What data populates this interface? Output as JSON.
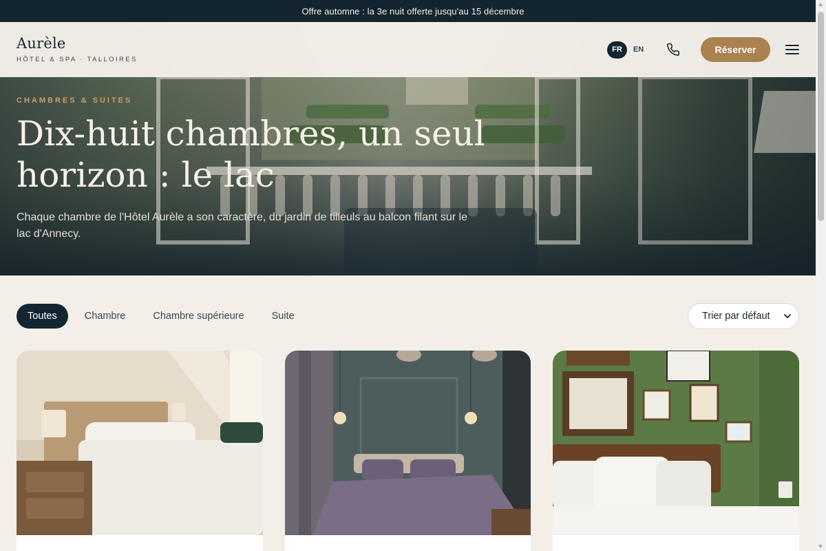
{
  "promo": {
    "text": "Offre automne : la 3e nuit offerte jusqu'au 15 décembre"
  },
  "header": {
    "brand_name": "Aurèle",
    "brand_tag": "HÔTEL & SPA · TALLOIRES",
    "languages": [
      "FR",
      "EN"
    ],
    "active_language": "FR",
    "phone_icon": "phone-icon",
    "reserve_label": "Réserver",
    "menu_icon": "hamburger-menu-icon"
  },
  "hero": {
    "eyebrow": "CHAMBRES & SUITES",
    "title": "Dix-huit chambres, un seul horizon : le lac",
    "subtitle": "Chaque chambre de l'Hôtel Aurèle a son caractère, du jardin de tilleuls au balcon filant sur le lac d'Annecy."
  },
  "filters": {
    "chips": [
      "Toutes",
      "Chambre",
      "Chambre supérieure",
      "Suite"
    ],
    "active": "Toutes",
    "sort_value": "Trier par défaut"
  },
  "cards": [
    {
      "image": "room-photo-warm-bedroom"
    },
    {
      "image": "room-photo-slate-bedroom"
    },
    {
      "image": "room-photo-green-bedroom"
    }
  ],
  "colors": {
    "dark": "#132530",
    "accent": "#a9824f",
    "eyebrow": "#c8a06b",
    "background": "#f3efe8"
  }
}
